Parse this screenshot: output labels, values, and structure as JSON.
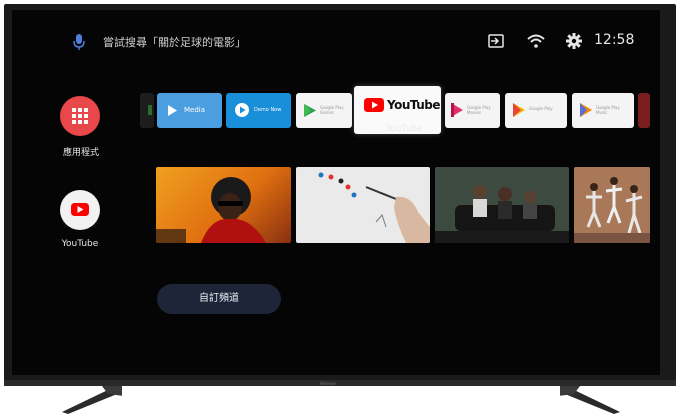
{
  "search_hint": "嘗試搜尋「關於足球的電影」",
  "clock": "12:58",
  "left_column": {
    "apps_label": "應用程式",
    "youtube_label": "YouTube"
  },
  "channels": {
    "media_label": "Media",
    "demo_label": "Demo Now",
    "games_label_line1": "Google Play",
    "games_label_line2": "Games",
    "youtube_tile_text": "YouTube",
    "youtube_caption": "YouTube",
    "movies_label_line1": "Google Play",
    "movies_label_line2": "Movies",
    "play_store_label": "Google Play",
    "play_music_label_line1": "Google Play",
    "play_music_label_line2": "Music"
  },
  "custom_channel_button": "自訂頻道",
  "brand": "Hisense",
  "colors": {
    "apps_red": "#e8474b",
    "youtube_red": "#ff0000",
    "media_blue": "#4b9ee0",
    "demo_blue": "#1a8fd9",
    "button_navy": "#1e2538"
  },
  "icons": [
    "mic-icon",
    "input-source-icon",
    "wifi-icon",
    "gear-icon",
    "apps-grid-icon",
    "youtube-play-icon"
  ]
}
